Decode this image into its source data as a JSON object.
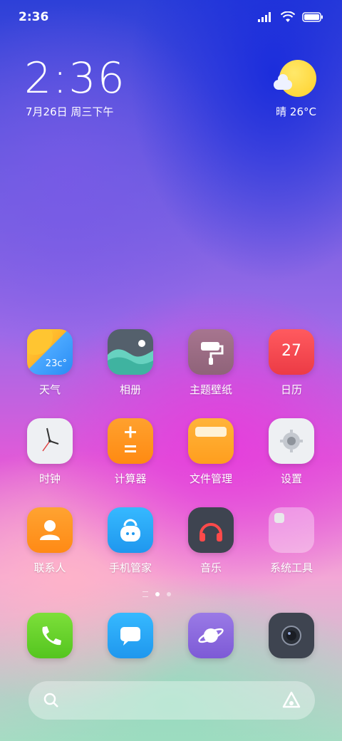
{
  "status": {
    "time": "2:36"
  },
  "clock": {
    "time": "2:36",
    "date": "7月26日 周三下午"
  },
  "weather": {
    "text": "晴 26°C"
  },
  "apps": [
    {
      "label": "天气",
      "badge": "23c°"
    },
    {
      "label": "相册"
    },
    {
      "label": "主题壁纸"
    },
    {
      "label": "日历",
      "day": "27"
    },
    {
      "label": "时钟"
    },
    {
      "label": "计算器"
    },
    {
      "label": "文件管理"
    },
    {
      "label": "设置"
    },
    {
      "label": "联系人"
    },
    {
      "label": "手机管家"
    },
    {
      "label": "音乐"
    },
    {
      "label": "系统工具"
    }
  ],
  "pager": {
    "pages": 2,
    "current": 1
  },
  "dock": [
    "phone-icon",
    "messages-icon",
    "browser-icon",
    "camera-icon"
  ]
}
